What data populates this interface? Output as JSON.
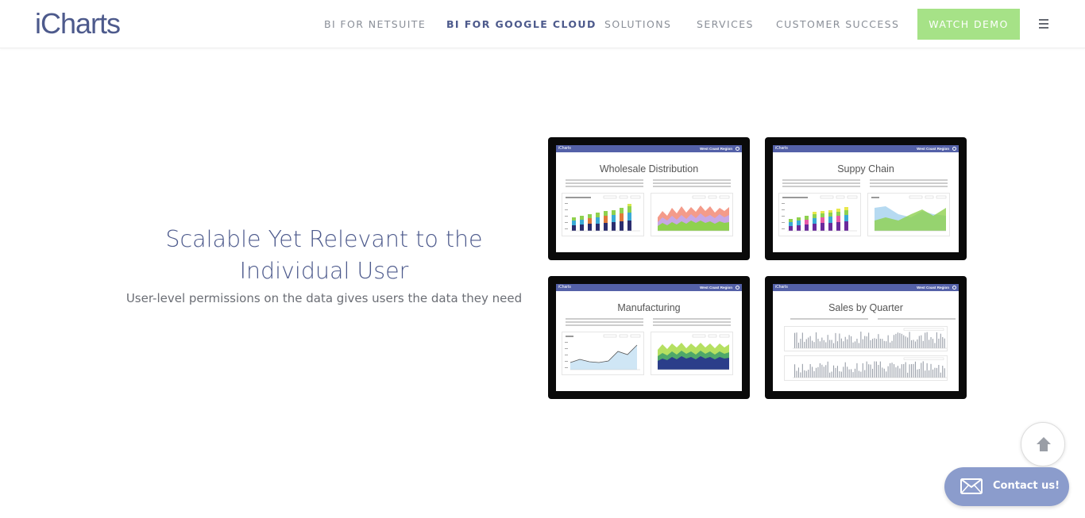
{
  "header": {
    "logo": "iCharts",
    "nav": [
      {
        "label": "BI FOR NETSUITE",
        "active": false
      },
      {
        "label": "BI FOR GOOGLE CLOUD",
        "active": true
      },
      {
        "label": "SOLUTIONS",
        "active": false
      },
      {
        "label": "SERVICES",
        "active": false
      },
      {
        "label": "CUSTOMER SUCCESS",
        "active": false
      }
    ],
    "cta_label": "WATCH DEMO",
    "menu_icon": "hamburger-icon"
  },
  "hero": {
    "headline_line1": "Scalable Yet Relevant to the",
    "headline_line2": "Individual User",
    "subline": "User-level permissions on the data gives users the data they need"
  },
  "dashboards": [
    {
      "app_name": "iCharts",
      "region": "West Coast Region",
      "title": "Wholesale Distribution"
    },
    {
      "app_name": "iCharts",
      "region": "West Coast Region",
      "title": "Suppy Chain"
    },
    {
      "app_name": "iCharts",
      "region": "West Coast Region",
      "title": "Manufacturing"
    },
    {
      "app_name": "iCharts",
      "region": "West Coast Region",
      "title": "Sales by Quarter"
    }
  ],
  "widgets": {
    "scroll_top_icon": "arrow-up-icon",
    "contact_icon": "envelope-icon",
    "contact_label": "Contact us!"
  },
  "colors": {
    "brand": "#4d5a8c",
    "cta": "#a6e287",
    "app_bar": "#5461a8",
    "contact": "#8b9ccc"
  }
}
